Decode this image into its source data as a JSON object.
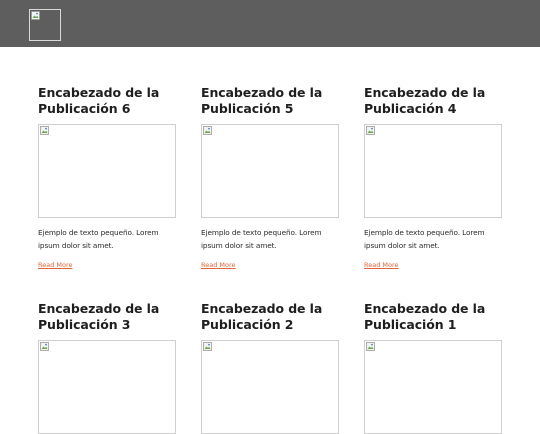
{
  "header": {
    "logo_icon": "broken-image-icon",
    "background": "#5e5e5e"
  },
  "posts": [
    {
      "title": "Encabezado de la Publicación 6",
      "text": "Ejemplo de texto pequeño. Lorem ipsum dolor sit amet.",
      "link": "Read More"
    },
    {
      "title": "Encabezado de la Publicación 5",
      "text": "Ejemplo de texto pequeño. Lorem ipsum dolor sit amet.",
      "link": "Read More"
    },
    {
      "title": "Encabezado de la Publicación 4",
      "text": "Ejemplo de texto pequeño. Lorem ipsum dolor sit amet.",
      "link": "Read More"
    },
    {
      "title": "Encabezado de la Publicación 3"
    },
    {
      "title": "Encabezado de la Publicación 2"
    },
    {
      "title": "Encabezado de la Publicación 1"
    }
  ],
  "colors": {
    "link": "#e0663a",
    "title": "#1f1f1f"
  }
}
